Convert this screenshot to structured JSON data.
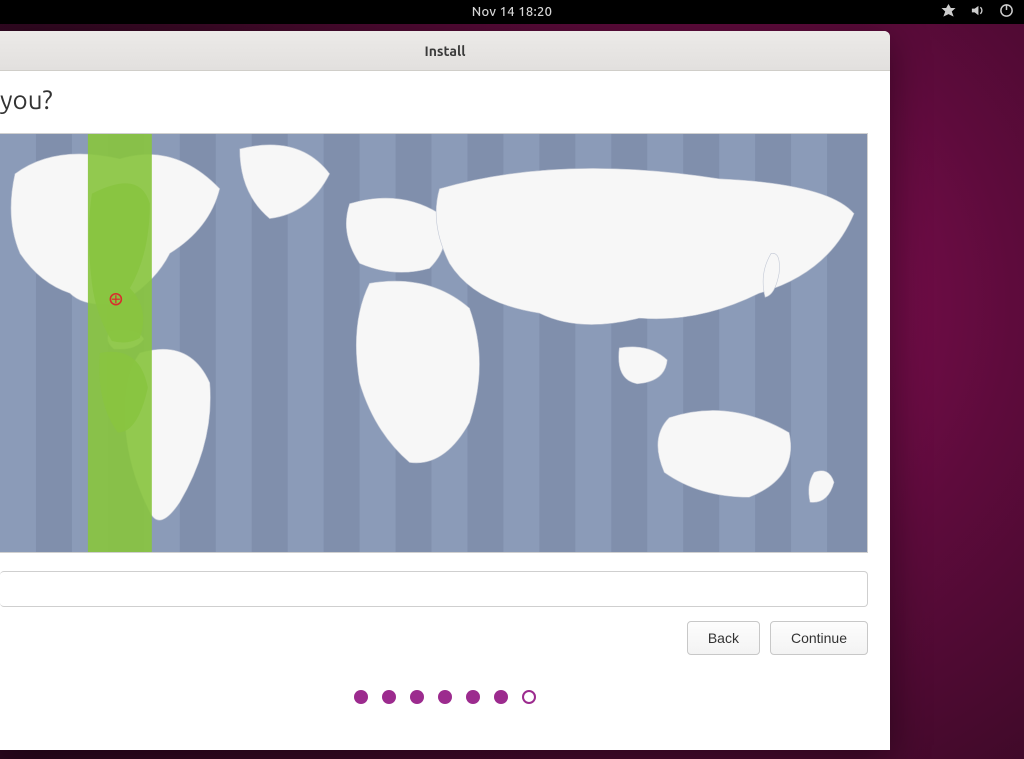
{
  "menubar": {
    "clock": "Nov 14  18:20"
  },
  "installer": {
    "window_title": "Install",
    "heading": "you?",
    "location_value": "",
    "buttons": {
      "back": "Back",
      "continue": "Continue"
    },
    "progress": {
      "total": 7,
      "filled": 6
    }
  }
}
